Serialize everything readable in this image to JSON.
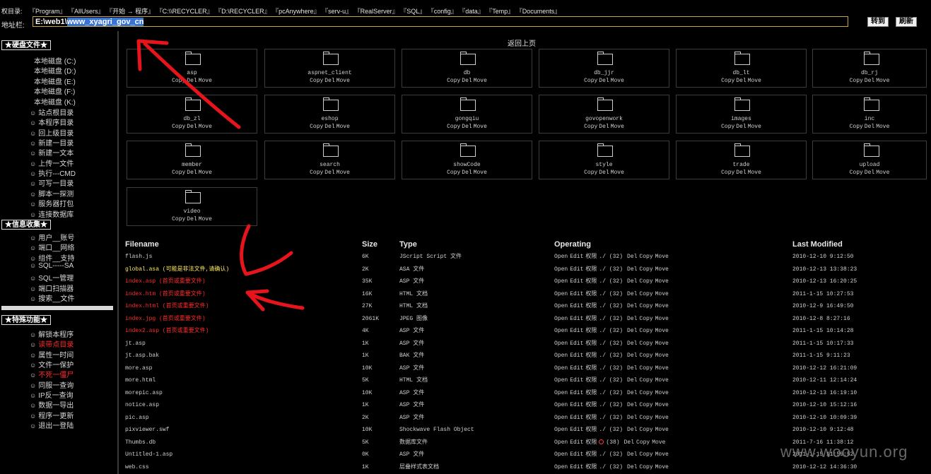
{
  "topbar": {
    "perm_dirs_label": "权目录:",
    "perm_dirs": [
      "『Program』",
      "『AllUsers』",
      "『开始 → 程序』",
      "『C:\\\\RECYCLER』",
      "『D:\\RECYCLER』",
      "『pcAnywhere』",
      "『serv-u』",
      "『RealServer』",
      "『SQL』",
      "『config』",
      "『data』",
      "『Temp』",
      "『Documents』"
    ],
    "address_label": "地址栏:",
    "address_prefix": "E:\\web1\\",
    "address_selected": "www_xyagri_gov_cn",
    "goto_label": "转到",
    "refresh_label": "刷新"
  },
  "sidebar": {
    "disk_section": "★硬盘文件★",
    "drives": [
      "本地磁盘 (C:)",
      "本地磁盘 (D:)",
      "本地磁盘 (E:)",
      "本地磁盘 (F:)",
      "本地磁盘 (K:)"
    ],
    "disk_items": [
      "站点根目录",
      "本程序目录",
      "回上级目录",
      "新建一目录",
      "新建一文本",
      "上传一文件",
      "执行---CMD",
      "可写一目录",
      "脚本一探测",
      "服务器打包",
      "连接数据库"
    ],
    "info_section": "★信息收集★",
    "info_items": [
      "用户__账号",
      "端口__网络",
      "组件__支持",
      "SQL-----SA",
      "SQL一管理",
      "端口扫描器",
      "搜索__文件"
    ],
    "special_section": "★特殊功能★",
    "special_items": [
      {
        "label": "解锁本程序",
        "red": false
      },
      {
        "label": "读带点目录",
        "red": true
      },
      {
        "label": "属性一时间",
        "red": false
      },
      {
        "label": "文件一保护",
        "red": false
      },
      {
        "label": "不死一僵尸",
        "red": true
      },
      {
        "label": "同服一查询",
        "red": false
      },
      {
        "label": "IP反一查询",
        "red": false
      },
      {
        "label": "数据一导出",
        "red": false
      },
      {
        "label": "程序一更新",
        "red": false
      },
      {
        "label": "退出一登陆",
        "red": false
      }
    ]
  },
  "main": {
    "back_label": "返回上页",
    "folder_actions": [
      "Copy",
      "Del",
      "Move"
    ],
    "folders": [
      "asp",
      "aspnet_client",
      "db",
      "db_jjr",
      "db_lt",
      "db_rj",
      "db_zl",
      "eshop",
      "gongqiu",
      "govopenwork",
      "images",
      "inc",
      "member",
      "search",
      "showCode",
      "style",
      "trade",
      "upload",
      "video"
    ]
  },
  "table": {
    "headers": {
      "filename": "Filename",
      "size": "Size",
      "type": "Type",
      "operating": "Operating",
      "modified": "Last Modified"
    },
    "op_labels": {
      "open": "Open",
      "edit": "Edit",
      "perm": "权限",
      "del": "Del",
      "copy": "Copy",
      "move": "Move"
    },
    "rows": [
      {
        "name": "flash.js",
        "size": "6K",
        "type": "JScript Script 文件",
        "perm": "./ (32)",
        "modified": "2010-12-10 9:12:50",
        "color": "normal"
      },
      {
        "name": "global.asa (可能是非法文件,请确认)",
        "size": "2K",
        "type": "ASA 文件",
        "perm": "./ (32)",
        "modified": "2010-12-13 13:38:23",
        "color": "yellow"
      },
      {
        "name": "index.asp (首页或重要文件)",
        "size": "35K",
        "type": "ASP 文件",
        "perm": "./ (32)",
        "modified": "2010-12-13 16:20:25",
        "color": "red"
      },
      {
        "name": "index.htm (首页或重要文件)",
        "size": "16K",
        "type": "HTML 文档",
        "perm": "./ (32)",
        "modified": "2011-1-15 10:27:53",
        "color": "red"
      },
      {
        "name": "index.html (首页或重要文件)",
        "size": "27K",
        "type": "HTML 文档",
        "perm": "./ (32)",
        "modified": "2010-12-9 16:49:50",
        "color": "red"
      },
      {
        "name": "index.jpg (首页或重要文件)",
        "size": "2061K",
        "type": "JPEG 图像",
        "perm": "./ (32)",
        "modified": "2010-12-8 8:27:16",
        "color": "red"
      },
      {
        "name": "index2.asp (首页或重要文件)",
        "size": "4K",
        "type": "ASP 文件",
        "perm": "./ (32)",
        "modified": "2011-1-15 10:14:28",
        "color": "red"
      },
      {
        "name": "jt.asp",
        "size": "1K",
        "type": "ASP 文件",
        "perm": "./ (32)",
        "modified": "2011-1-15 10:17:33",
        "color": "normal"
      },
      {
        "name": "jt.asp.bak",
        "size": "1K",
        "type": "BAK 文件",
        "perm": "./ (32)",
        "modified": "2011-1-15 9:11:23",
        "color": "normal"
      },
      {
        "name": "more.asp",
        "size": "10K",
        "type": "ASP 文件",
        "perm": "./ (32)",
        "modified": "2010-12-12 16:21:09",
        "color": "normal"
      },
      {
        "name": "more.html",
        "size": "5K",
        "type": "HTML 文档",
        "perm": "./ (32)",
        "modified": "2010-12-11 12:14:24",
        "color": "normal"
      },
      {
        "name": "morepic.asp",
        "size": "10K",
        "type": "ASP 文件",
        "perm": "./ (32)",
        "modified": "2010-12-13 16:19:10",
        "color": "normal"
      },
      {
        "name": "notice.asp",
        "size": "1K",
        "type": "ASP 文件",
        "perm": "./ (32)",
        "modified": "2010-12-10 15:12:16",
        "color": "normal"
      },
      {
        "name": "pic.asp",
        "size": "2K",
        "type": "ASP 文件",
        "perm": "./ (32)",
        "modified": "2010-12-10 10:09:39",
        "color": "normal"
      },
      {
        "name": "pixviewer.swf",
        "size": "10K",
        "type": "Shockwave Flash Object",
        "perm": "./ (32)",
        "modified": "2010-12-10 9:12:48",
        "color": "normal"
      },
      {
        "name": "Thumbs.db",
        "size": "5K",
        "type": "数据库文件",
        "perm": "(38)",
        "modified": "2011-7-16 11:38:12",
        "color": "normal",
        "perm_icon": true
      },
      {
        "name": "Untitled-1.asp",
        "size": "0K",
        "type": "ASP 文件",
        "perm": "./ (32)",
        "modified": "2011-1-15 11:59:52",
        "color": "normal"
      },
      {
        "name": "web.css",
        "size": "1K",
        "type": "层叠样式表文档",
        "perm": "./ (32)",
        "modified": "2010-12-12 14:36:30",
        "color": "normal"
      }
    ]
  },
  "watermark": "www.wooyun.org",
  "colors": {
    "background": "#000000",
    "accent_red": "#ff2a2a",
    "warning_yellow": "#ffe95a",
    "address_border": "#c8a640",
    "selection": "#3874d8"
  }
}
